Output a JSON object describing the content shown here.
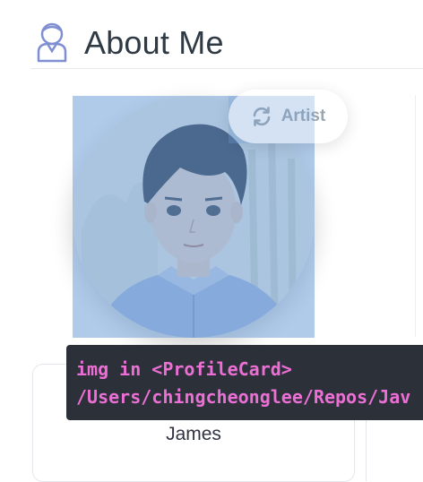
{
  "header": {
    "title": "About Me",
    "icon": "user-icon"
  },
  "profile": {
    "avatar_icon": "avatar-illustration",
    "role_toggle": {
      "label": "Artist",
      "icon": "refresh-icon"
    },
    "name": "James"
  },
  "inspector": {
    "element_label": "img in <ProfileCard>",
    "file_path": "/Users/chingcheonglee/Repos/Jav"
  },
  "colors": {
    "overlay": "#6fa0d8",
    "tooltip_bg": "#2c3038",
    "tooltip_text": "#ec6fd6",
    "title_text": "#2f3a45",
    "icon_stroke": "#7f8fd1"
  }
}
